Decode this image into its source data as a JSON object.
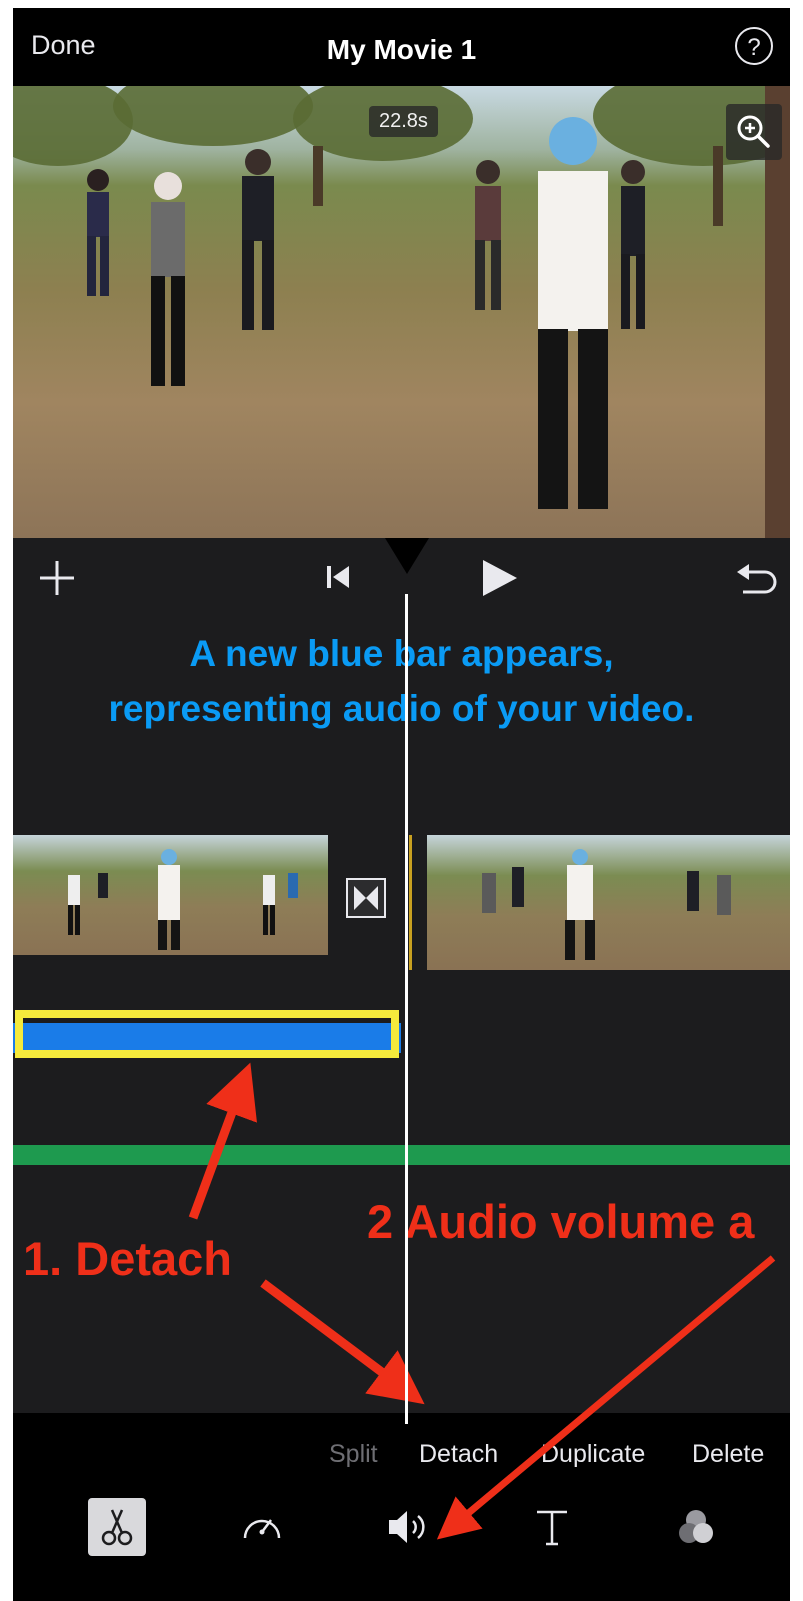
{
  "header": {
    "done_label": "Done",
    "title": "My Movie 1",
    "help_glyph": "?"
  },
  "viewer": {
    "duration": "22.8s",
    "zoom_icon": "zoom-in-icon"
  },
  "transport": {
    "add_icon": "plus-icon",
    "rewind_icon": "skip-to-start-icon",
    "play_icon": "play-icon",
    "undo_icon": "undo-icon"
  },
  "caption": {
    "line1": "A new blue bar appears,",
    "line2": "representing audio of your video."
  },
  "annotations": {
    "step1": "1. Detach",
    "step2": "2  Audio volume a"
  },
  "edit_menu": {
    "items": [
      {
        "label": "Split",
        "enabled": false
      },
      {
        "label": "Detach",
        "enabled": true
      },
      {
        "label": "Duplicate",
        "enabled": true
      },
      {
        "label": "Delete",
        "enabled": true
      }
    ]
  },
  "toolbar": {
    "tools": [
      "scissors-icon",
      "speed-icon",
      "volume-icon",
      "title-text-icon",
      "filters-icon"
    ],
    "active": "scissors-icon"
  },
  "colors": {
    "caption_blue": "#0a9bf5",
    "annotation_red": "#ef2f19",
    "highlight_yellow": "#f5ea3c",
    "audio_blue": "#1a7ce8",
    "music_green": "#1e9a4f"
  }
}
